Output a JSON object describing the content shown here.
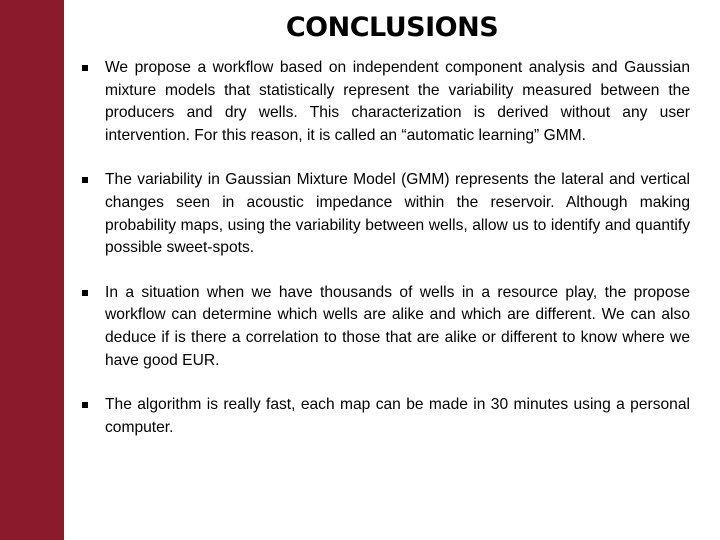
{
  "slide": {
    "title": "CONCLUSIONS",
    "accent_color": "#8b1a2c",
    "bullets": [
      {
        "text": "We propose a workflow based on independent component analysis and Gaussian mixture models that statistically represent the variability measured between the producers and dry wells. This characterization is derived without any user intervention. For this reason, it is called an “automatic learning” GMM."
      },
      {
        "text": "The variability in Gaussian Mixture Model (GMM) represents the lateral and vertical changes seen in acoustic impedance within the reservoir. Although making probability maps, using the variability between wells, allow us to identify and quantify possible sweet-spots."
      },
      {
        "text": "In a situation when we have thousands of wells in a resource play, the propose workflow can determine which wells are alike and which are different. We can also deduce if is there a correlation to those that are alike or different to know where we have good EUR."
      },
      {
        "text": "The algorithm is really fast, each map can be made in 30 minutes using a personal computer."
      }
    ]
  }
}
